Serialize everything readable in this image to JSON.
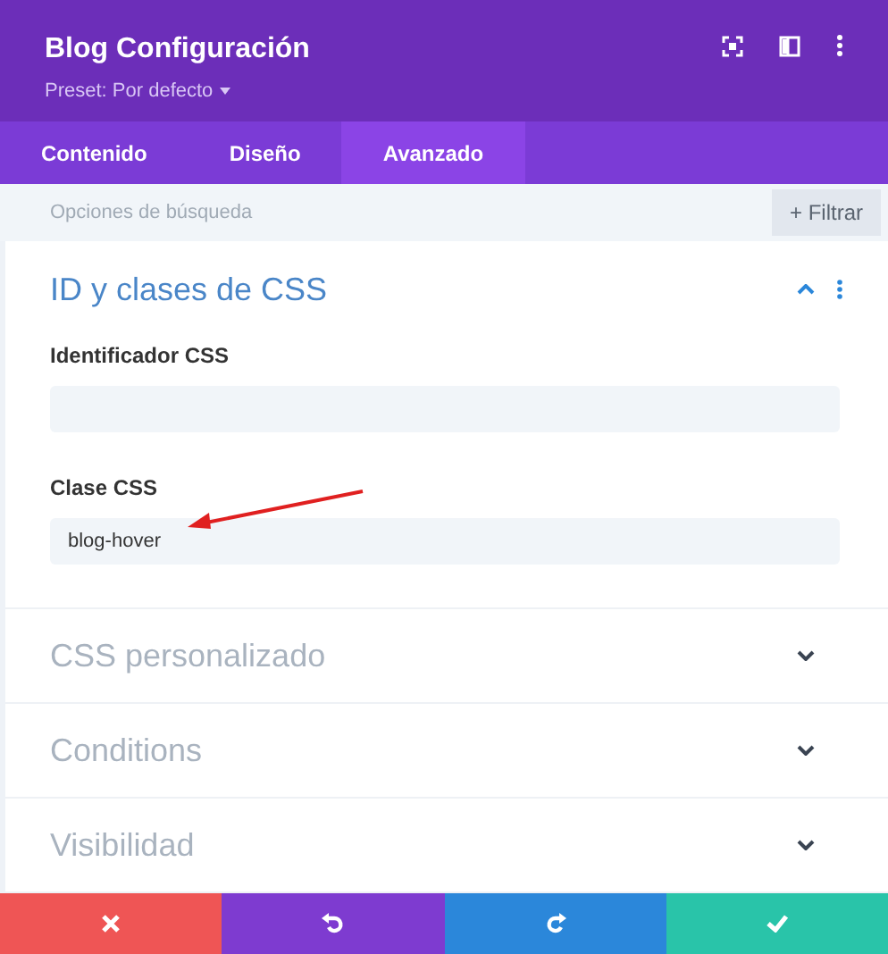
{
  "header": {
    "title": "Blog Configuración",
    "preset": "Preset: Por defecto"
  },
  "tabs": [
    {
      "label": "Contenido",
      "selected": false
    },
    {
      "label": "Diseño",
      "selected": false
    },
    {
      "label": "Avanzado",
      "selected": true
    }
  ],
  "search": {
    "placeholder": "Opciones de búsqueda",
    "filter_button": "+ Filtrar"
  },
  "sections": [
    {
      "title": "ID y clases de CSS",
      "expanded": true,
      "fields": [
        {
          "label": "Identificador CSS"
        },
        {
          "label": "Clase CSS",
          "value": "blog-hover"
        }
      ]
    },
    {
      "title": "CSS personalizado",
      "expanded": false
    },
    {
      "title": "Conditions",
      "expanded": false
    },
    {
      "title": "Visibilidad",
      "expanded": false
    }
  ],
  "footer_buttons": [
    {
      "kind": "cancel"
    },
    {
      "kind": "undo"
    },
    {
      "kind": "redo"
    },
    {
      "kind": "save"
    }
  ]
}
